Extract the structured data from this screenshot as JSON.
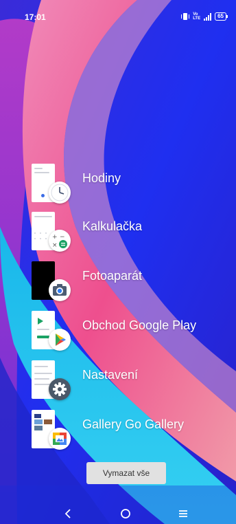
{
  "status_bar": {
    "time": "17:01",
    "network_top": "Vo",
    "network_bottom": "LTE",
    "signal_type": "4G",
    "battery": "65"
  },
  "recents": [
    {
      "label": "Hodiny",
      "icon": "clock-icon"
    },
    {
      "label": "Kalkulačka",
      "icon": "calculator-icon"
    },
    {
      "label": "Fotoaparát",
      "icon": "camera-icon"
    },
    {
      "label": "Obchod Google Play",
      "icon": "play-store-icon"
    },
    {
      "label": "Nastavení",
      "icon": "settings-gear-icon"
    },
    {
      "label": "Gallery Go Gallery",
      "icon": "gallery-go-icon"
    }
  ],
  "clear_all_label": "Vymazat vše",
  "nav": {
    "back_icon": "back-chevron-icon",
    "home_icon": "home-circle-icon",
    "recents_icon": "menu-lines-icon"
  },
  "colors": {
    "background": "#2430e6",
    "pink_wave": "#ef4f92",
    "cyan_wave": "#2cc6ee",
    "clear_button": "#e1e1e1"
  }
}
